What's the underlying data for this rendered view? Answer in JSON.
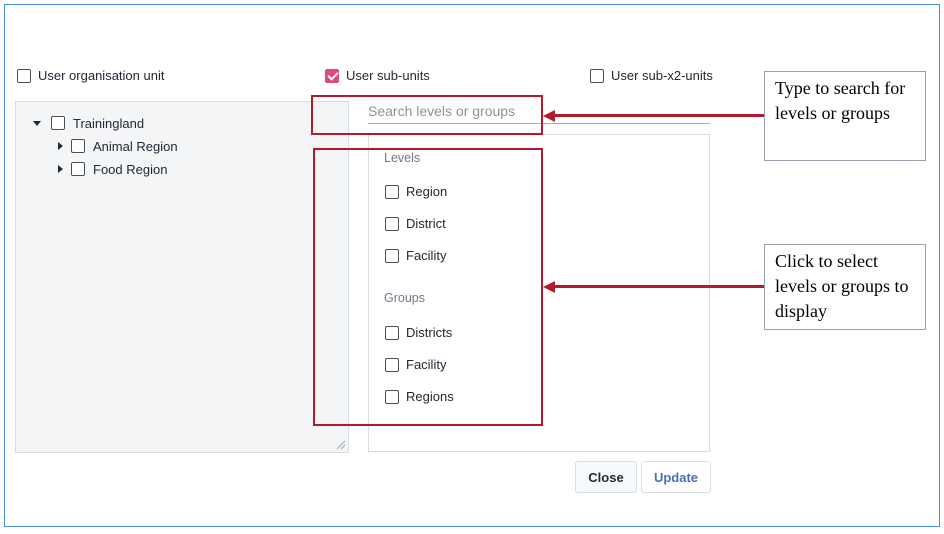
{
  "options": {
    "user_org_unit": "User organisation unit",
    "user_org_unit_checked": false,
    "user_sub_units": "User sub-units",
    "user_sub_units_checked": true,
    "user_sub_x2_units": "User sub-x2-units",
    "user_sub_x2_units_checked": false
  },
  "tree": {
    "root": "Trainingland",
    "children": [
      "Animal Region",
      "Food Region"
    ]
  },
  "search": {
    "placeholder": "Search levels or groups",
    "value": ""
  },
  "levels": {
    "title": "Levels",
    "items": [
      "Region",
      "District",
      "Facility"
    ]
  },
  "groups": {
    "title": "Groups",
    "items": [
      "Districts",
      "Facility",
      "Regions"
    ]
  },
  "buttons": {
    "close": "Close",
    "update": "Update"
  },
  "callouts": {
    "search": "Type to search for levels or groups",
    "select": "Click to select levels or groups to display"
  },
  "colors": {
    "accent_checkbox": "#e2487a",
    "highlight": "#b01c2e",
    "frame": "#4a90d9",
    "update_text": "#4a6fb5"
  }
}
